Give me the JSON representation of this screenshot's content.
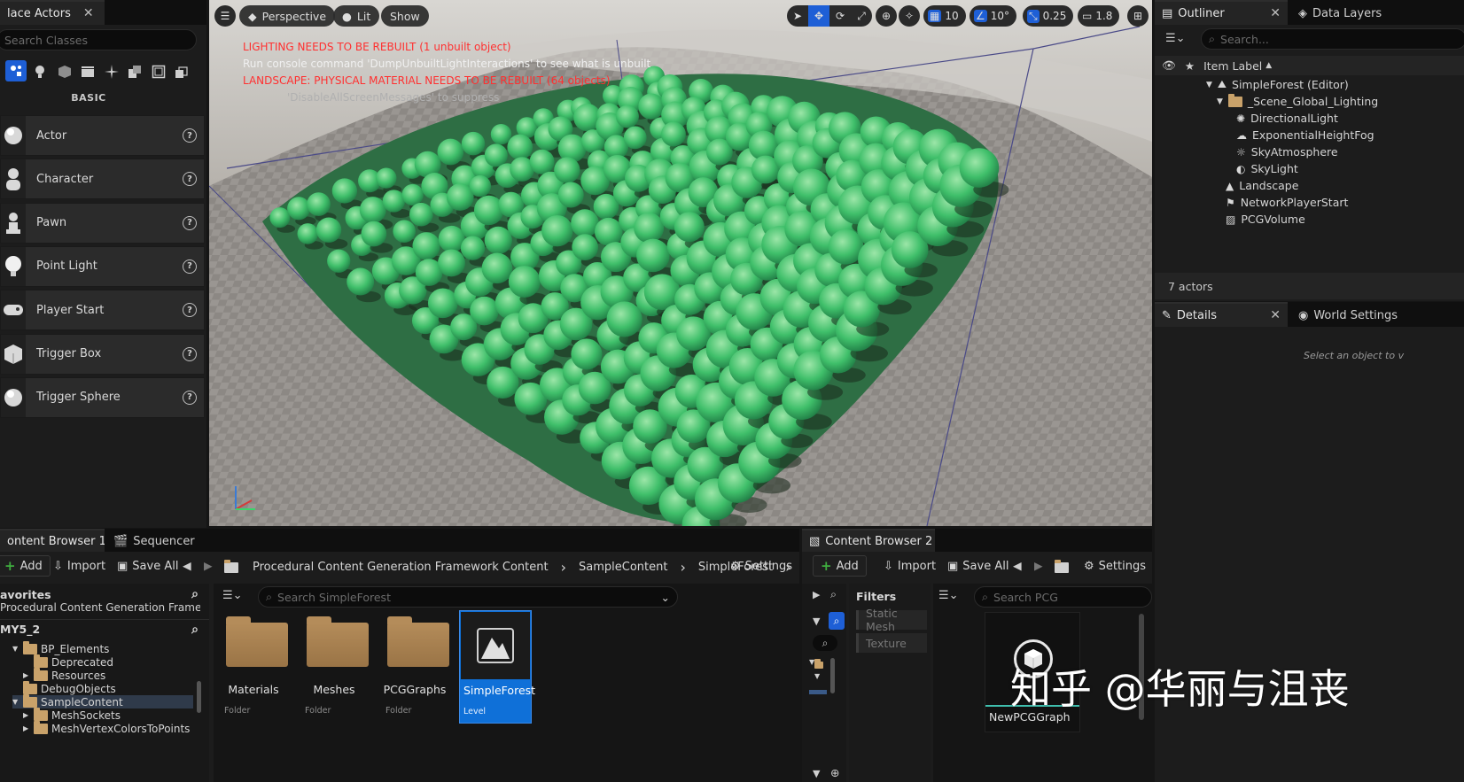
{
  "place_actors": {
    "tab_title": "lace Actors",
    "search_placeholder": "Search Classes",
    "section_label": "BASIC",
    "items": [
      {
        "label": "Actor",
        "icon": "sphere-icon"
      },
      {
        "label": "Character",
        "icon": "character-icon"
      },
      {
        "label": "Pawn",
        "icon": "pawn-icon"
      },
      {
        "label": "Point Light",
        "icon": "bulb-icon"
      },
      {
        "label": "Player Start",
        "icon": "gamepad-icon"
      },
      {
        "label": "Trigger Box",
        "icon": "box-icon"
      },
      {
        "label": "Trigger Sphere",
        "icon": "sphere-icon"
      }
    ]
  },
  "viewport": {
    "perspective_label": "Perspective",
    "lit_label": "Lit",
    "show_label": "Show",
    "grid_snap": "10",
    "rotation_snap": "10°",
    "scale_snap": "0.25",
    "camera_speed": "1.8",
    "messages": [
      {
        "text": "LIGHTING NEEDS TO BE REBUILT (1 unbuilt object)",
        "color": "#ff3030"
      },
      {
        "text": "Run console command 'DumpUnbuiltLightInteractions' to see what is unbuilt",
        "color": "#f0f0f0"
      },
      {
        "text": "LANDSCAPE: PHYSICAL MATERIAL NEEDS TO BE REBUILT (64 objects)",
        "color": "#ff3030"
      },
      {
        "text": "'DisableAllScreenMessages' to suppress",
        "color": "#b0b0b0"
      }
    ]
  },
  "outliner": {
    "tab_title": "Outliner",
    "data_layers_tab": "Data Layers",
    "search_placeholder": "Search...",
    "column_label": "Item Label",
    "items": [
      {
        "label": "SimpleForest (Editor)",
        "icon": "level-icon"
      },
      {
        "label": "_Scene_Global_Lighting",
        "icon": "folder-icon"
      },
      {
        "label": "DirectionalLight",
        "icon": "sun-icon"
      },
      {
        "label": "ExponentialHeightFog",
        "icon": "fog-icon"
      },
      {
        "label": "SkyAtmosphere",
        "icon": "atmosphere-icon"
      },
      {
        "label": "SkyLight",
        "icon": "skylight-icon"
      },
      {
        "label": "Landscape",
        "icon": "landscape-icon"
      },
      {
        "label": "NetworkPlayerStart",
        "icon": "playerstart-icon"
      },
      {
        "label": "PCGVolume",
        "icon": "volume-icon"
      }
    ],
    "actor_count": "7 actors"
  },
  "details": {
    "tab_title": "Details",
    "world_settings_tab": "World Settings",
    "empty_hint": "Select an object to v"
  },
  "content_browser_1": {
    "tab_title": "ontent Browser 1",
    "sequencer_tab": "Sequencer",
    "add_label": "Add",
    "import_label": "Import",
    "save_all_label": "Save All",
    "settings_label": "Settings",
    "breadcrumb": [
      "Procedural Content Generation Framework Content",
      "SampleContent",
      "SimpleForest"
    ],
    "favorites_label": "avorites",
    "favorite_item": "Procedural Content Generation Framew",
    "project_label": "MY5_2",
    "tree": [
      {
        "label": "BP_Elements",
        "expanded": true
      },
      {
        "label": "Deprecated"
      },
      {
        "label": "Resources"
      },
      {
        "label": "DebugObjects"
      },
      {
        "label": "SampleContent",
        "expanded": true,
        "selected": true
      },
      {
        "label": "MeshSockets"
      },
      {
        "label": "MeshVertexColorsToPoints"
      }
    ],
    "search_placeholder": "Search SimpleForest",
    "assets": [
      {
        "name": "Materials",
        "kind": "Folder"
      },
      {
        "name": "Meshes",
        "kind": "Folder"
      },
      {
        "name": "PCGGraphs",
        "kind": "Folder"
      },
      {
        "name": "SimpleForest",
        "kind": "Level",
        "selected": true
      }
    ]
  },
  "content_browser_2": {
    "tab_title": "Content Browser 2",
    "add_label": "Add",
    "import_label": "Import",
    "save_all_label": "Save All",
    "settings_label": "Settings",
    "filters_label": "Filters",
    "filters": [
      "Static Mesh",
      "Texture"
    ],
    "search_placeholder": "Search PCG",
    "asset_name": "NewPCGGraph"
  },
  "watermark": "知乎 @华丽与沮丧",
  "colors": {
    "accent_blue": "#1e5fd6",
    "add_green": "#3fae3f",
    "folder": "#c9a26a"
  }
}
